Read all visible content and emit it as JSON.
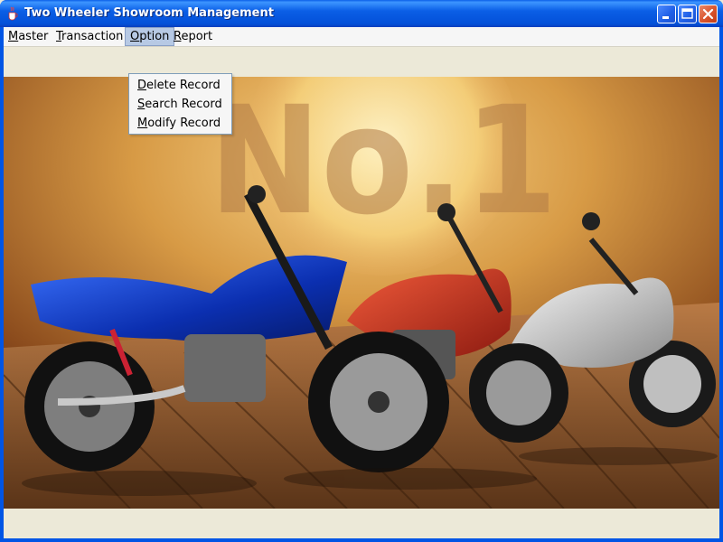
{
  "window": {
    "title": "Two Wheeler Showroom Management"
  },
  "menubar": {
    "items": [
      {
        "first": "M",
        "rest": "aster"
      },
      {
        "first": "T",
        "rest": "ransaction"
      },
      {
        "first": "O",
        "rest": "ption"
      },
      {
        "first": "R",
        "rest": "eport"
      }
    ]
  },
  "option_menu": {
    "items": [
      {
        "first": "D",
        "rest": "elete Record"
      },
      {
        "first": "S",
        "rest": "earch Record"
      },
      {
        "first": "M",
        "rest": "odify Record"
      }
    ]
  },
  "banner": {
    "headline": "No.1",
    "description": "Three motorcycles (blue, red, silver) on a wooden deck against a sunset sky"
  },
  "colors": {
    "title_bar": "#0a5fe8",
    "menu_highlight": "#b7c9e4",
    "close_button": "#d9532c"
  }
}
